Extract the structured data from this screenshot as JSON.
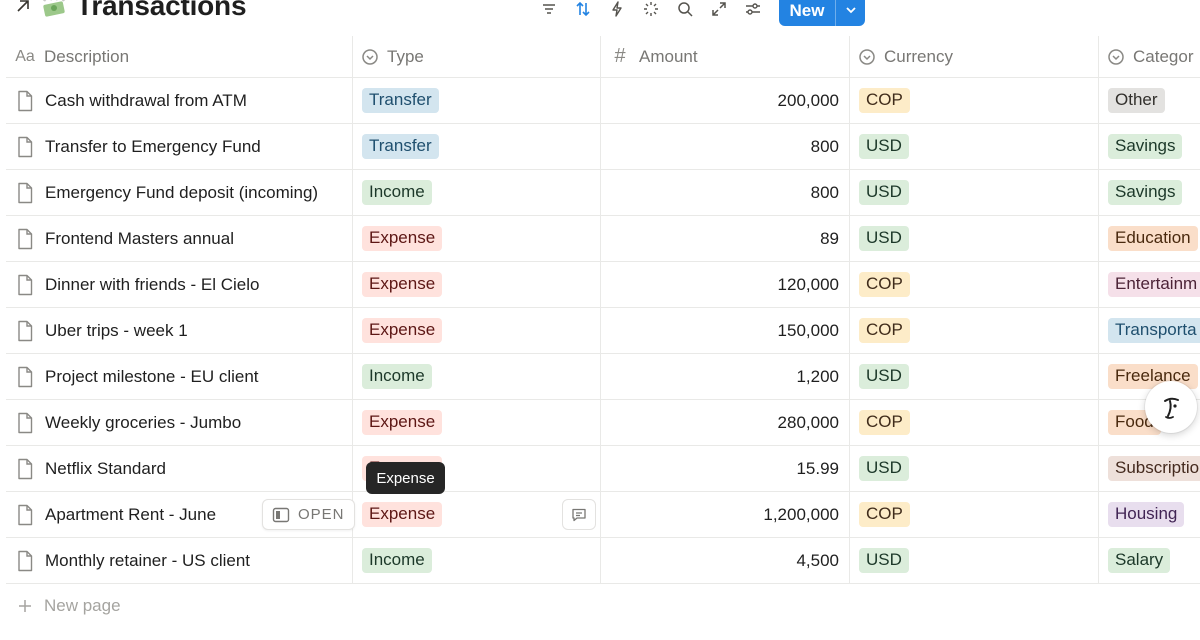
{
  "header": {
    "title": "Transactions",
    "new_button": "New"
  },
  "toolbar": {
    "icons": [
      "filter-icon",
      "sort-icon",
      "automation-icon",
      "ai-sparkle-icon",
      "search-icon",
      "expand-icon",
      "settings-icon"
    ]
  },
  "columns": {
    "description": {
      "label": "Description",
      "icon_text": "Aa"
    },
    "type": {
      "label": "Type"
    },
    "amount": {
      "label": "Amount",
      "icon_text": "#"
    },
    "currency": {
      "label": "Currency"
    },
    "category": {
      "label": "Categor"
    }
  },
  "rows": [
    {
      "description": "Cash withdrawal from ATM",
      "type": "Transfer",
      "amount": "200,000",
      "currency": "COP",
      "category": "Other"
    },
    {
      "description": "Transfer to Emergency Fund",
      "type": "Transfer",
      "amount": "800",
      "currency": "USD",
      "category": "Savings"
    },
    {
      "description": "Emergency Fund deposit (incoming)",
      "type": "Income",
      "amount": "800",
      "currency": "USD",
      "category": "Savings"
    },
    {
      "description": "Frontend Masters annual",
      "type": "Expense",
      "amount": "89",
      "currency": "USD",
      "category": "Education"
    },
    {
      "description": "Dinner with friends - El Cielo",
      "type": "Expense",
      "amount": "120,000",
      "currency": "COP",
      "category": "Entertainm"
    },
    {
      "description": "Uber trips - week 1",
      "type": "Expense",
      "amount": "150,000",
      "currency": "COP",
      "category": "Transporta"
    },
    {
      "description": "Project milestone - EU client",
      "type": "Income",
      "amount": "1,200",
      "currency": "USD",
      "category": "Freelance"
    },
    {
      "description": "Weekly groceries - Jumbo",
      "type": "Expense",
      "amount": "280,000",
      "currency": "COP",
      "category": "Food"
    },
    {
      "description": "Netflix Standard",
      "type": "Expense",
      "amount": "15.99",
      "currency": "USD",
      "category": "Subscriptio"
    },
    {
      "description": "Apartment Rent - June",
      "type": "Expense",
      "amount": "1,200,000",
      "currency": "COP",
      "category": "Housing"
    },
    {
      "description": "Monthly retainer - US client",
      "type": "Income",
      "amount": "4,500",
      "currency": "USD",
      "category": "Salary"
    }
  ],
  "row_actions": {
    "open_label": "OPEN"
  },
  "tooltip": "Expense",
  "footer": {
    "new_page": "New page"
  },
  "colors": {
    "accent": "#2383e2",
    "tag_blue": "#d3e5ef",
    "tag_green": "#dbeddb",
    "tag_red": "#ffe2dd",
    "tag_yellow": "#fdecc8",
    "tag_gray": "#e3e2e0",
    "tag_orange": "#fadec9",
    "tag_pink": "#f5e0e9",
    "tag_brown": "#eee0da",
    "tag_purple": "#e8deee"
  }
}
